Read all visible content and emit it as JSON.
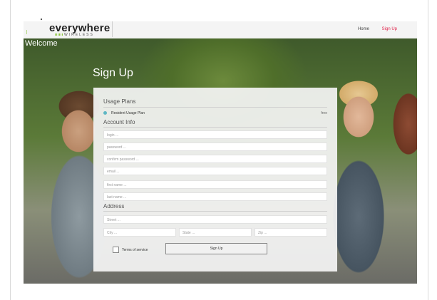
{
  "brand": {
    "name": "everywhere",
    "sub": "WIRELESS"
  },
  "nav": {
    "home": "Home",
    "signup": "Sign Up"
  },
  "hero": {
    "welcome": "Welcome",
    "title": "Sign Up"
  },
  "form": {
    "usage_title": "Usage Plans",
    "plan_name": "Resident Usage Plan",
    "plan_price": "free",
    "account_title": "Account Info",
    "login_ph": "login ...",
    "password_ph": "password ...",
    "confirm_ph": "confirm password ...",
    "email_ph": "email ...",
    "first_ph": "first name ...",
    "last_ph": "last name ...",
    "address_title": "Address",
    "street_ph": "Street ...",
    "city_ph": "City ...",
    "state_ph": "State ...",
    "zip_ph": "Zip ...",
    "terms_label": "Terms of service",
    "submit_label": "Sign Up"
  },
  "colors": {
    "accent": "#e0244c",
    "radio": "#5fb7c4",
    "logo_green": "#8cc63f"
  }
}
